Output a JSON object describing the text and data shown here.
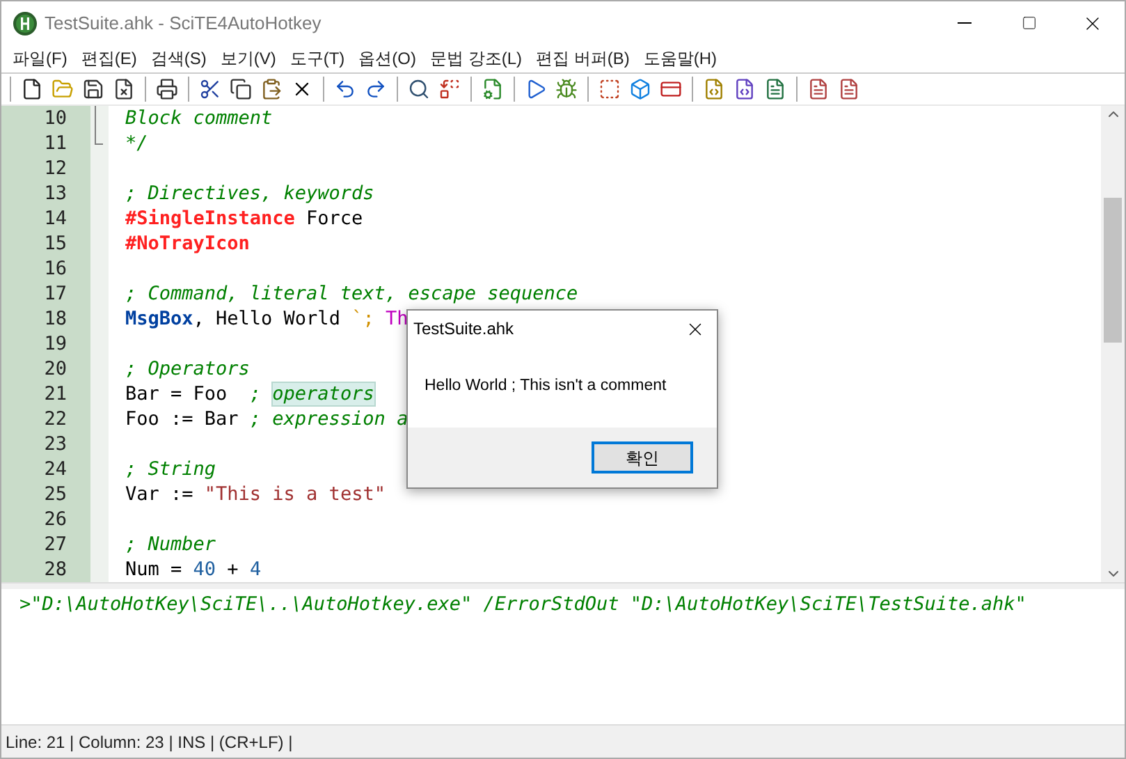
{
  "window": {
    "title": "TestSuite.ahk - SciTE4AutoHotkey"
  },
  "menu": [
    "파일(F)",
    "편집(E)",
    "검색(S)",
    "보기(V)",
    "도구(T)",
    "옵션(O)",
    "문법 강조(L)",
    "편집 버퍼(B)",
    "도움말(H)"
  ],
  "editor": {
    "lines": [
      {
        "number": "10",
        "fold_line": true,
        "tokens": [
          {
            "kind": "comment",
            "text": "Block comment"
          }
        ]
      },
      {
        "number": "11",
        "fold_end": true,
        "tokens": [
          {
            "kind": "comment",
            "text": "*/"
          }
        ]
      },
      {
        "number": "12"
      },
      {
        "number": "13",
        "tokens": [
          {
            "kind": "comment",
            "text": "; Directives, keywords"
          }
        ]
      },
      {
        "number": "14",
        "tokens": [
          {
            "kind": "directive",
            "text": "#SingleInstance"
          },
          {
            "kind": "plain",
            "text": " Force"
          }
        ]
      },
      {
        "number": "15",
        "tokens": [
          {
            "kind": "directive",
            "text": "#NoTrayIcon"
          }
        ]
      },
      {
        "number": "16"
      },
      {
        "number": "17",
        "tokens": [
          {
            "kind": "comment",
            "text": "; Command, literal text, escape sequence"
          }
        ]
      },
      {
        "number": "18",
        "tokens": [
          {
            "kind": "command",
            "text": "MsgBox"
          },
          {
            "kind": "plain",
            "text": ", Hello World "
          },
          {
            "kind": "escape",
            "text": "`;"
          },
          {
            "kind": "literal",
            "text": " Th"
          }
        ]
      },
      {
        "number": "19"
      },
      {
        "number": "20",
        "tokens": [
          {
            "kind": "comment",
            "text": "; Operators"
          }
        ]
      },
      {
        "number": "21",
        "tokens": [
          {
            "kind": "plain",
            "text": "Bar = Foo  "
          },
          {
            "kind": "comment",
            "text": "; "
          },
          {
            "kind": "comment-highlight",
            "text": "operators"
          }
        ]
      },
      {
        "number": "22",
        "tokens": [
          {
            "kind": "plain",
            "text": "Foo := Bar "
          },
          {
            "kind": "comment",
            "text": "; expression a"
          }
        ]
      },
      {
        "number": "23"
      },
      {
        "number": "24",
        "tokens": [
          {
            "kind": "comment",
            "text": "; String"
          }
        ]
      },
      {
        "number": "25",
        "tokens": [
          {
            "kind": "plain",
            "text": "Var := "
          },
          {
            "kind": "string",
            "text": "\"This is a test\""
          }
        ]
      },
      {
        "number": "26"
      },
      {
        "number": "27",
        "tokens": [
          {
            "kind": "comment",
            "text": "; Number"
          }
        ]
      },
      {
        "number": "28",
        "tokens": [
          {
            "kind": "plain",
            "text": "Num = "
          },
          {
            "kind": "number",
            "text": "40"
          },
          {
            "kind": "plain",
            "text": " + "
          },
          {
            "kind": "number",
            "text": "4"
          }
        ]
      }
    ]
  },
  "output": {
    "lines": [
      ">\"D:\\AutoHotKey\\SciTE\\..\\AutoHotkey.exe\" /ErrorStdOut \"D:\\AutoHotKey\\SciTE\\TestSuite.ahk\""
    ]
  },
  "dialog": {
    "title": "TestSuite.ahk",
    "message": "Hello World ; This isn't a comment",
    "button": "확인"
  },
  "status_bar": "Line: 21 | Column: 23 | INS | (CR+LF) |"
}
